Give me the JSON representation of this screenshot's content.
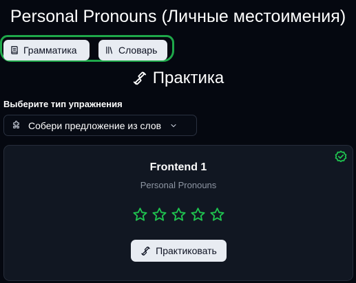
{
  "header": {
    "title": "Personal Pronouns (Личные местоимения)"
  },
  "nav": {
    "grammar_label": "Грамматика",
    "vocab_label": "Словарь"
  },
  "practice": {
    "title": "Практика",
    "exercise_label": "Выберите тип упражнения",
    "exercise_selected": "Собери предложение из слов"
  },
  "card": {
    "title": "Frontend 1",
    "subtitle": "Personal Pronouns",
    "rating": {
      "value": 0,
      "max": 5
    },
    "completed": true,
    "button_label": "Практиковать"
  },
  "colors": {
    "background": "#050810",
    "accent_green": "#1fc24f",
    "pill_bg": "#e8ecf2",
    "card_bg": "#111722"
  },
  "icons": {
    "grammar": "book-icon",
    "vocab": "library-icon",
    "practice": "dumbbell-icon",
    "exercise": "puzzle-icon",
    "select": "chevron-down-icon",
    "completed": "badge-check-icon",
    "rating": "star-icon"
  }
}
